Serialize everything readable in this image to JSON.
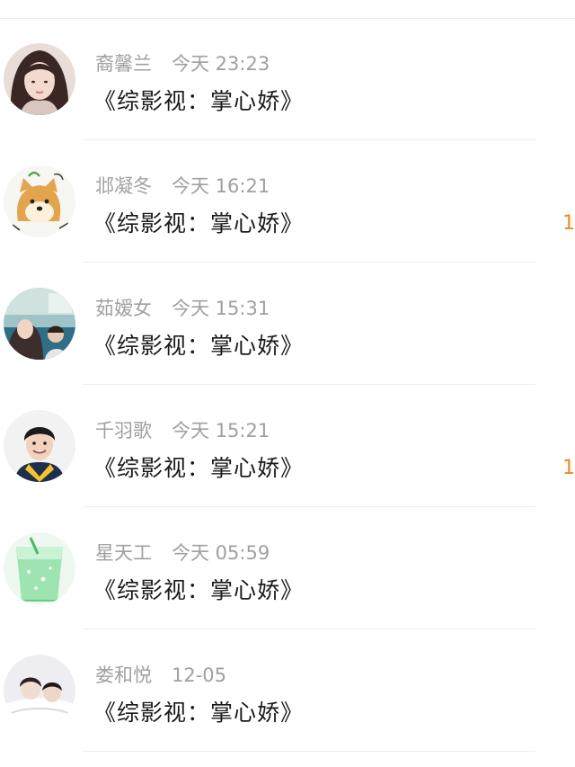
{
  "messages": [
    {
      "username": "裔馨兰",
      "time": "今天 23:23",
      "title": "《综影视：掌心娇》",
      "edge_count": "",
      "avatar_icon": "girl-portrait"
    },
    {
      "username": "邶凝冬",
      "time": "今天 16:21",
      "title": "《综影视：掌心娇》",
      "edge_count": "1",
      "avatar_icon": "shiba-doge-sticker"
    },
    {
      "username": "茹嫒女",
      "time": "今天 15:31",
      "title": "《综影视：掌心娇》",
      "edge_count": "",
      "avatar_icon": "couple-on-train"
    },
    {
      "username": "千羽歌",
      "time": "今天 15:21",
      "title": "《综影视：掌心娇》",
      "edge_count": "1",
      "avatar_icon": "smiling-boy"
    },
    {
      "username": "星天工",
      "time": "今天 05:59",
      "title": "《综影视：掌心娇》",
      "edge_count": "",
      "avatar_icon": "green-soda-glass"
    },
    {
      "username": "娄和悦",
      "time": "12-05",
      "title": "《综影视：掌心娇》",
      "edge_count": "",
      "avatar_icon": "couple-in-bed"
    }
  ],
  "colors": {
    "username": "#a0a0a0",
    "title": "#1a1a1a",
    "accent": "#f0882a",
    "divider": "#eeeeee"
  }
}
